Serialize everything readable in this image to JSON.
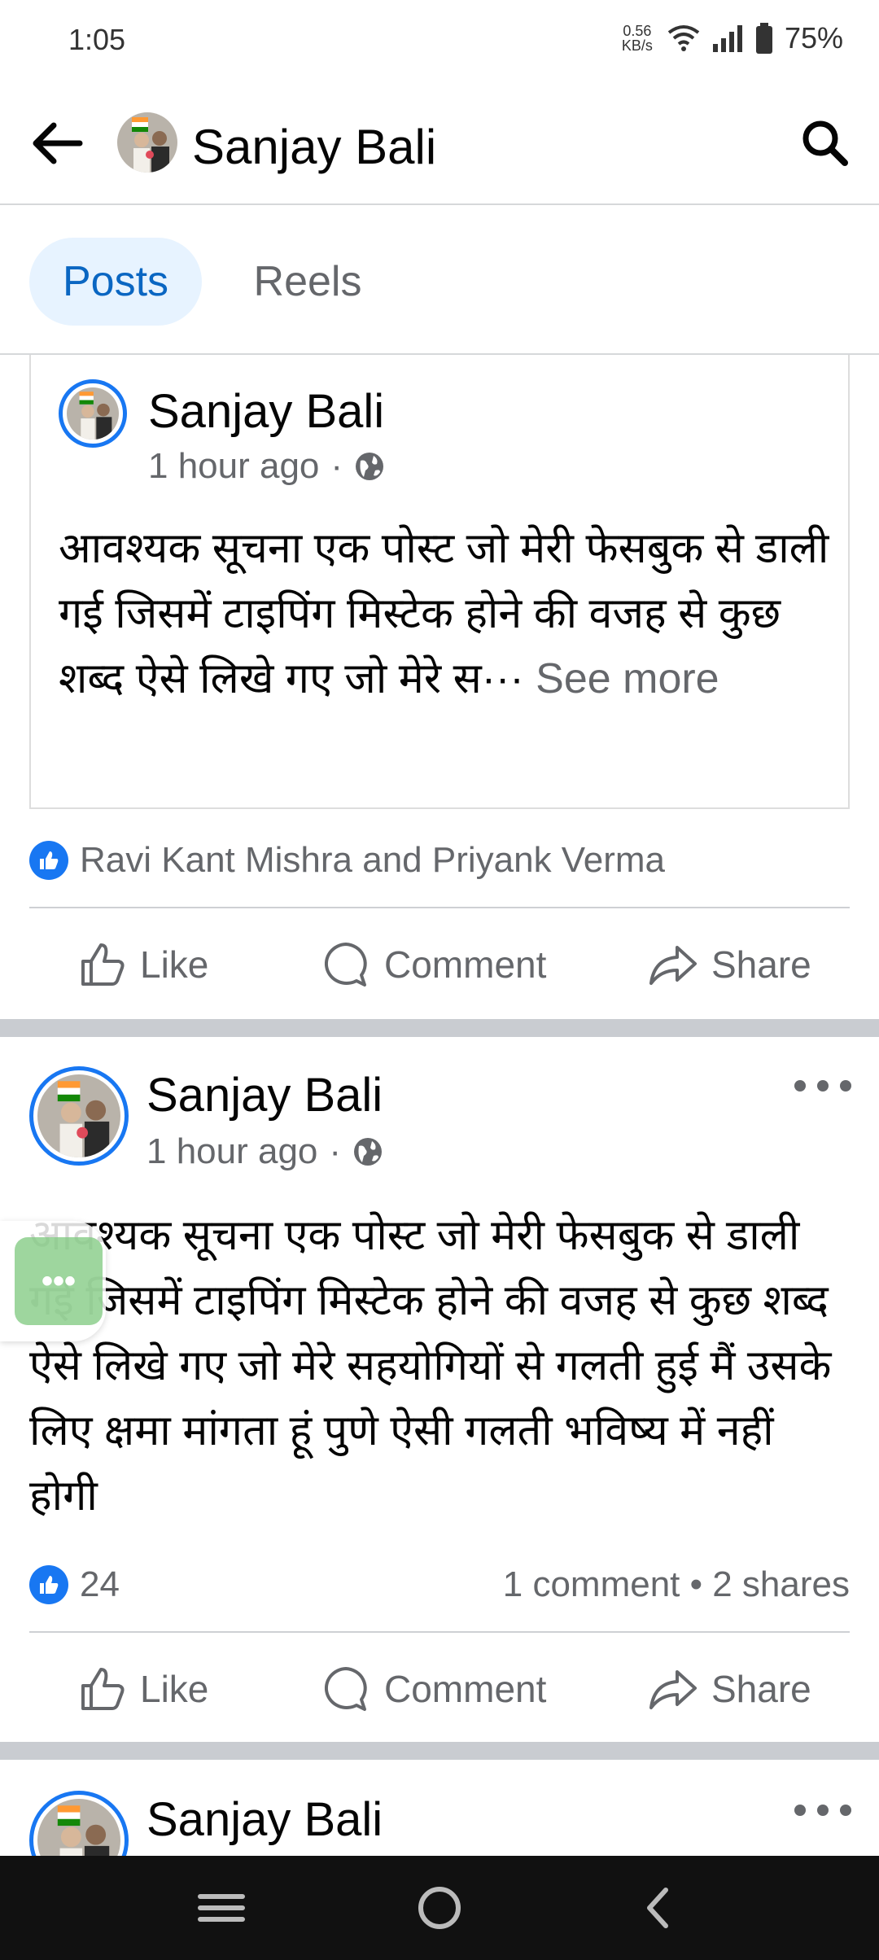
{
  "status_bar": {
    "time": "1:05",
    "net_speed_top": "0.56",
    "net_speed_bottom": "KB/s",
    "battery": "75%"
  },
  "header": {
    "title": "Sanjay Bali"
  },
  "tabs": [
    {
      "label": "Posts"
    },
    {
      "label": "Reels"
    }
  ],
  "posts": [
    {
      "author": "Sanjay Bali",
      "time": "1 hour ago",
      "separator": "·",
      "text": "आवश्यक सूचना एक पोस्ट जो मेरी फेसबुक से डाली गई जिसमें टाइपिंग मिस्टेक होने की वजह से कुछ शब्द ऐसे लिखे गए जो मेरे स···",
      "see_more": "See more",
      "reactions": "Ravi Kant Mishra and Priyank Verma",
      "actions": {
        "like": "Like",
        "comment": "Comment",
        "share": "Share"
      }
    },
    {
      "author": "Sanjay Bali",
      "time": "1 hour ago",
      "separator": "·",
      "text": "आवश्यक सूचना एक पोस्ट जो मेरी फेसबुक से डाली गई जिसमें टाइपिंग मिस्टेक होने की वजह से कुछ शब्द ऐसे लिखे गए जो मेरे सहयोगियों से गलती हुई मैं उसके लिए क्षमा मांगता हूं पुणे ऐसी गलती भविष्य में नहीं होगी",
      "reaction_count": "24",
      "counts": "1 comment • 2 shares",
      "actions": {
        "like": "Like",
        "comment": "Comment",
        "share": "Share"
      }
    },
    {
      "author": "Sanjay Bali"
    }
  ],
  "colors": {
    "accent": "#1877f2",
    "tab_active_bg": "#e7f3ff",
    "tab_active_text": "#0a66c2",
    "muted": "#65676b"
  }
}
